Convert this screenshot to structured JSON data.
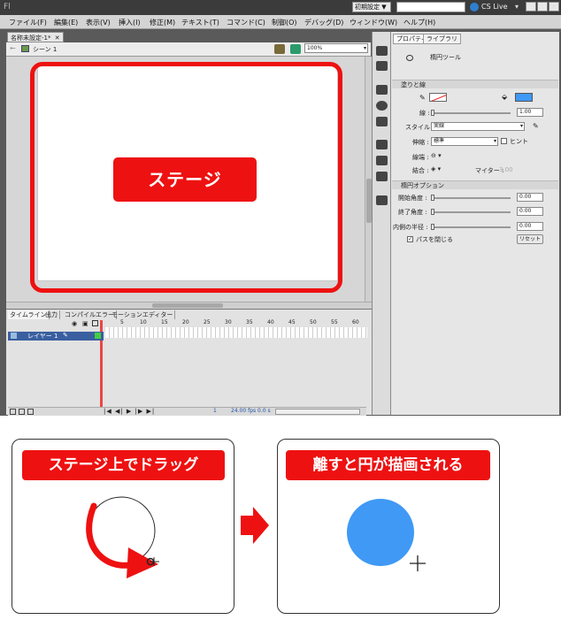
{
  "titlebar": {
    "app_icon": "Fl",
    "workspace_label": "初期設定 ▼",
    "search_placeholder": "",
    "cslive_label": "CS Live"
  },
  "menu": [
    "ファイル(F)",
    "編集(E)",
    "表示(V)",
    "挿入(I)",
    "修正(M)",
    "テキスト(T)",
    "コマンド(C)",
    "制御(O)",
    "デバッグ(D)",
    "ウィンドウ(W)",
    "ヘルプ(H)"
  ],
  "document": {
    "tab_label": "名称未設定-1*",
    "scene_label": "シーン 1",
    "zoom": "100%",
    "stage_label": "ステージ"
  },
  "timeline": {
    "tabs": [
      "タイムライン",
      "出力",
      "コンパイルエラー",
      "モーションエディター"
    ],
    "frame_numbers": [
      "5",
      "10",
      "15",
      "20",
      "25",
      "30",
      "35",
      "40",
      "45",
      "50",
      "55",
      "60"
    ],
    "layer_name": "レイヤー 1",
    "frame": "1",
    "fps": "24.00 fps",
    "time": "0.0 s"
  },
  "properties": {
    "tabs": [
      "プロパティ",
      "ライブラリ"
    ],
    "tool_name": "楕円ツール",
    "fill_stroke_section": "塗りと線",
    "stroke_label": "線 :",
    "stroke_value": "1.00",
    "style_label": "スタイル :",
    "style_value": "実線",
    "scale_label": "伸縮 :",
    "scale_value": "標準",
    "hint_label": "ヒント",
    "cap_label": "線端 :",
    "join_label": "結合 :",
    "miter_label": "マイター :",
    "miter_value": "3.00",
    "ellipse_section": "楕円オプション",
    "start_angle_label": "開始角度 :",
    "start_angle_value": "0.00",
    "end_angle_label": "終了角度 :",
    "end_angle_value": "0.00",
    "inner_radius_label": "内側の半径 :",
    "inner_radius_value": "0.00",
    "close_path_label": "パスを閉じる",
    "close_path_checked": true,
    "reset_label": "リセット",
    "fill_color": "#3f99f5",
    "stroke_color": "none"
  },
  "instructions": {
    "step1_label": "ステージ上でドラッグ",
    "step2_label": "離すと円が描画される",
    "circle_color": "#3f99f5",
    "accent_color": "#ee1111"
  }
}
